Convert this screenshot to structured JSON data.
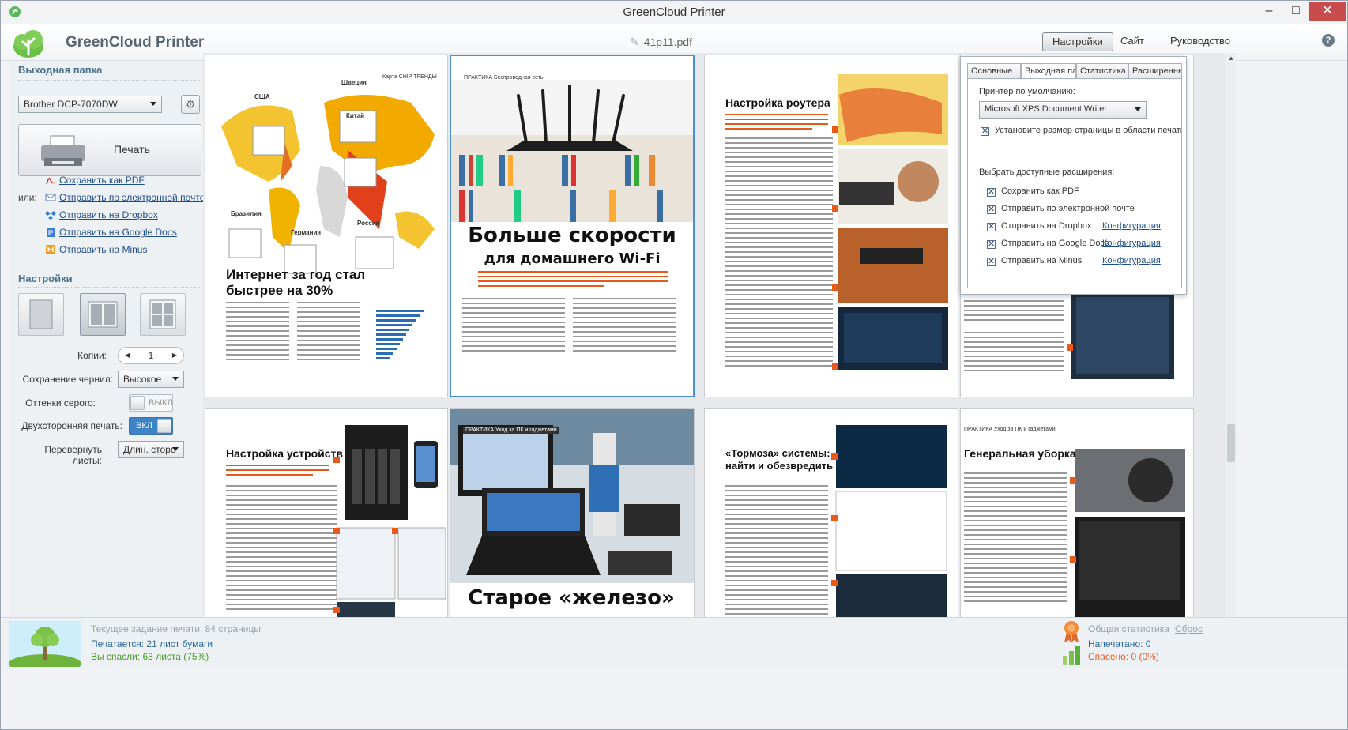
{
  "window": {
    "title": "GreenCloud Printer",
    "min": "–",
    "max": "□",
    "close": "✕"
  },
  "header": {
    "app_name": "GreenCloud Printer",
    "file_name": "41p11.pdf",
    "nav": {
      "settings": "Настройки",
      "site": "Сайт",
      "guide": "Руководство"
    },
    "help": "?"
  },
  "sidebar": {
    "output_title": "Выходная папка",
    "printer": "Brother DCP-7070DW",
    "print_label": "Печать",
    "or_label": "или:",
    "actions": [
      {
        "label": "Сохранить как PDF",
        "icon": "pdf-icon"
      },
      {
        "label": "Отправить по электронной почте",
        "icon": "email-icon"
      },
      {
        "label": "Отправить на Dropbox",
        "icon": "dropbox-icon"
      },
      {
        "label": "Отправить на Google Docs",
        "icon": "google-docs-icon"
      },
      {
        "label": "Отправить на Minus",
        "icon": "minus-icon"
      }
    ],
    "settings_title": "Настройки",
    "copies_label": "Копии:",
    "copies_value": "1",
    "ink_label": "Сохранение чернил:",
    "ink_value": "Высокое",
    "gray_label": "Оттенки серого:",
    "gray_value": "ВЫКЛ",
    "duplex_label": "Двухсторонняя печать:",
    "duplex_value": "ВКЛ",
    "flip_label": "Перевернуть листы:",
    "flip_value": "Длин. сторо"
  },
  "pages": {
    "p1": {
      "title": "Интернет за год стал быстрее на 30%",
      "tag": "Карта CHIP  ТРЕНДЫ",
      "labels": [
        "США",
        "Швеция",
        "Китай",
        "Бразилия",
        "Германия",
        "Россия"
      ]
    },
    "p2": {
      "tag": "ПРАКТИКА  Беспроводная сеть",
      "title": "Больше скорости",
      "subtitle": "для домашнего Wi-Fi"
    },
    "p3": {
      "title": "Настройка роутера"
    },
    "p5": {
      "title": "Настройка устройств"
    },
    "p6": {
      "tag": "ПРАКТИКА  Уход за ПК и гаджетами",
      "title": "Старое «железо»"
    },
    "p7": {
      "title": "«Тормоза» системы: найти и обезвредить"
    },
    "p8": {
      "tag": "ПРАКТИКА  Уход за ПК и гаджетами",
      "title": "Генеральная уборка"
    }
  },
  "settings_panel": {
    "tabs": [
      "Основные",
      "Выходная папка",
      "Статистика",
      "Расширенные"
    ],
    "default_printer_label": "Принтер по умолчанию:",
    "default_printer": "Microsoft XPS Document Writer",
    "page_size_label": "Установите размер страницы в области печати",
    "extensions_label": "Выбрать доступные расширения:",
    "extensions": [
      {
        "label": "Сохранить как PDF",
        "config": ""
      },
      {
        "label": "Отправить по электронной почте",
        "config": ""
      },
      {
        "label": "Отправить на Dropbox",
        "config": "Конфигурация"
      },
      {
        "label": "Отправить на Google Docs",
        "config": "Конфигурация"
      },
      {
        "label": "Отправить на Minus",
        "config": "Конфигурация"
      }
    ]
  },
  "footer": {
    "job": "Текущее задание печати: 84 страницы",
    "printing": "Печатается: 21 лист бумаги",
    "saved": "Вы спасли: 63 листа (75%)",
    "total_title": "Общая статистика",
    "reset": "Сброс",
    "printed": "Напечатано: 0",
    "saved_total": "Спасено: 0 (0%)"
  },
  "colors": {
    "accent": "#4a90d9",
    "brand_green": "#4caf50",
    "link": "#1f4d8a",
    "orange": "#e85a1b"
  }
}
